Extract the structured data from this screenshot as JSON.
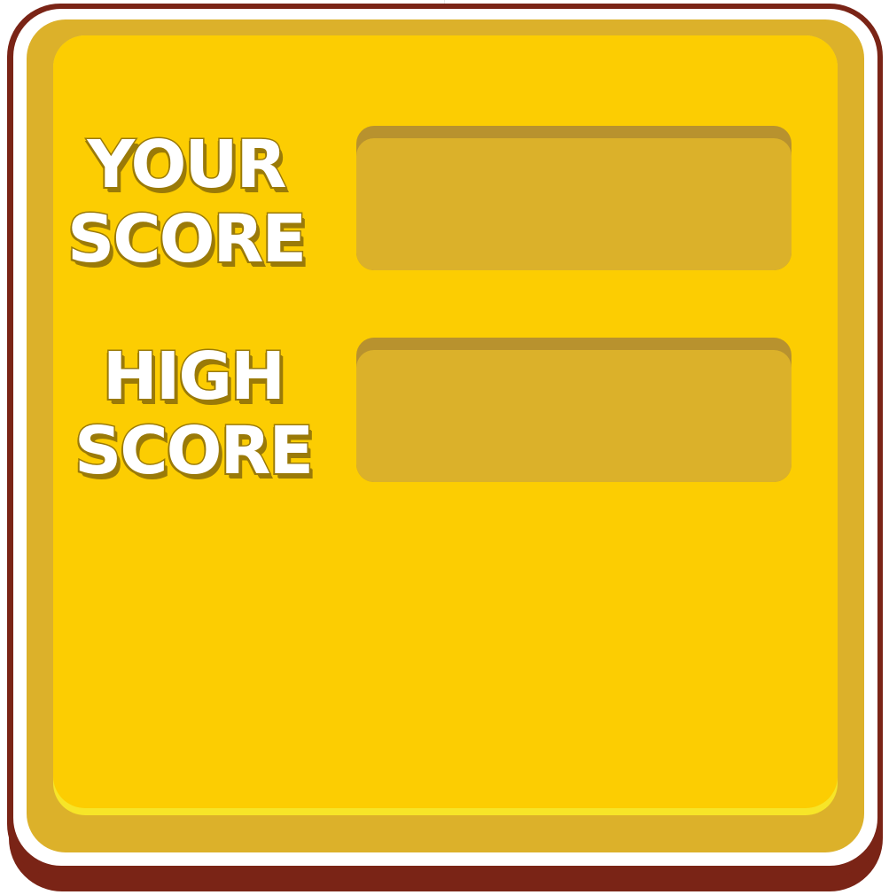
{
  "score_panel": {
    "your_score": {
      "label_line1": "YOUR",
      "label_line2": "SCORE",
      "value": ""
    },
    "high_score": {
      "label_line1": "HIGH",
      "label_line2": "SCORE",
      "value": ""
    }
  },
  "colors": {
    "outline": "#7a2416",
    "frame": "#dcb12a",
    "panel": "#fccd02",
    "panel_highlight": "#f7e528",
    "box_top": "#b8922e",
    "box_fill": "#dbb12a",
    "label_stroke": "#9a7a08"
  }
}
